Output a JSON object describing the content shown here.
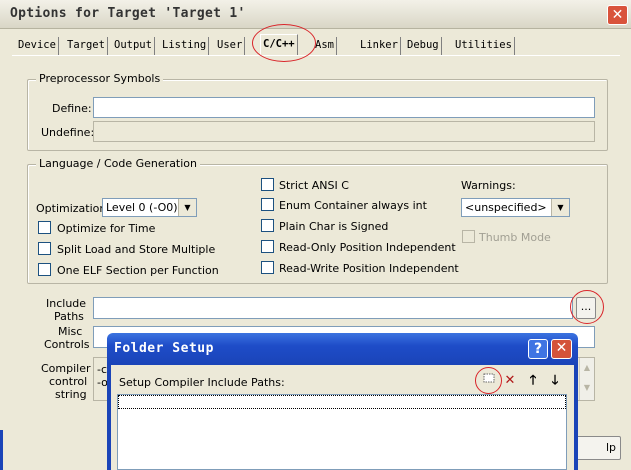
{
  "window": {
    "title": "Options for Target 'Target 1'"
  },
  "tabs": [
    "Device",
    "Target",
    "Output",
    "Listing",
    "User",
    "C/C++",
    "Asm",
    "Linker",
    "Debug",
    "Utilities"
  ],
  "active_tab": "C/C++",
  "preprocessor": {
    "legend": "Preprocessor Symbols",
    "define_label": "Define:",
    "define_value": "",
    "undefine_label": "Undefine:",
    "undefine_value": ""
  },
  "language": {
    "legend": "Language / Code Generation",
    "optimization_label": "Optimization:",
    "optimization_value": "Level 0 (-O0)",
    "checks_left": [
      {
        "label": "Optimize for Time",
        "checked": false
      },
      {
        "label": "Split Load and Store Multiple",
        "checked": false
      },
      {
        "label": "One ELF Section per Function",
        "checked": false
      }
    ],
    "checks_middle": [
      {
        "label": "Strict ANSI C",
        "checked": false
      },
      {
        "label": "Enum Container always int",
        "checked": false
      },
      {
        "label": "Plain Char is Signed",
        "checked": false
      },
      {
        "label": "Read-Only Position Independent",
        "checked": false
      },
      {
        "label": "Read-Write Position Independent",
        "checked": false
      }
    ],
    "warnings_label": "Warnings:",
    "warnings_value": "<unspecified>",
    "thumb_mode_label": "Thumb Mode"
  },
  "include_paths": {
    "label_line1": "Include",
    "label_line2": "Paths",
    "value": "",
    "browse_label": "..."
  },
  "misc_controls": {
    "label_line1": "Misc",
    "label_line2": "Controls",
    "value": ""
  },
  "compiler": {
    "label_line1": "Compiler",
    "label_line2": "control",
    "label_line3": "string",
    "text_line1": "-c",
    "text_line2": "-o"
  },
  "help_button_partial": "lp",
  "folder_setup": {
    "title": "Folder Setup",
    "help_label": "?",
    "close_label": "X",
    "prompt": "Setup Compiler Include Paths:",
    "toolbar": [
      "new-folder-icon",
      "delete-icon",
      "move-up-icon",
      "move-down-icon"
    ]
  },
  "colors": {
    "annotation": "#d9252a",
    "xp_blue": "#1a44b8"
  }
}
